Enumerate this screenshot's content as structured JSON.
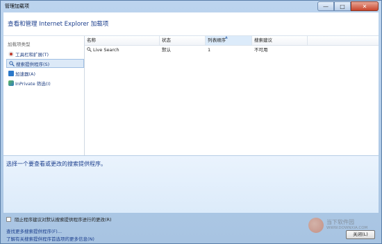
{
  "window": {
    "title": "管理加载项",
    "controls": {
      "minimize": "—",
      "maximize": "□",
      "close": "✕"
    }
  },
  "header": {
    "title": "查看和管理 Internet Explorer 加载项"
  },
  "sidebar": {
    "heading": "加载项类型",
    "items": [
      {
        "label": "工具栏和扩展(T)",
        "icon": "gear-icon",
        "selected": false
      },
      {
        "label": "搜索提供程序(S)",
        "icon": "search-icon",
        "selected": true
      },
      {
        "label": "加速器(A)",
        "icon": "accelerator-icon",
        "selected": false
      },
      {
        "label": "InPrivate 筛选(I)",
        "icon": "inprivate-icon",
        "selected": false
      }
    ]
  },
  "list": {
    "columns": [
      "名称",
      "状态",
      "列表顺序",
      "搜索建议"
    ],
    "rows": [
      {
        "name": "Live Search",
        "status": "默认",
        "order": "1",
        "suggestions": "不可用"
      }
    ]
  },
  "details": {
    "text": "选择一个要查看或更改的搜索提供程序。"
  },
  "options": {
    "block_default_change": "阻止程序建议对默认搜索提供程序进行的更改(R)"
  },
  "footer": {
    "links": [
      "查找更多搜索提供程序(F)...",
      "了解有关搜索提供程序首选项的更多信息(N)"
    ],
    "close_button": "关闭(L)"
  },
  "watermark": {
    "name": "当下软件园",
    "url": "WWW.DOWNXIA.COM"
  },
  "colors": {
    "accent": "#1a3d8c",
    "selected_bg": "#dce9f7",
    "details_bg": "#e4effb"
  }
}
